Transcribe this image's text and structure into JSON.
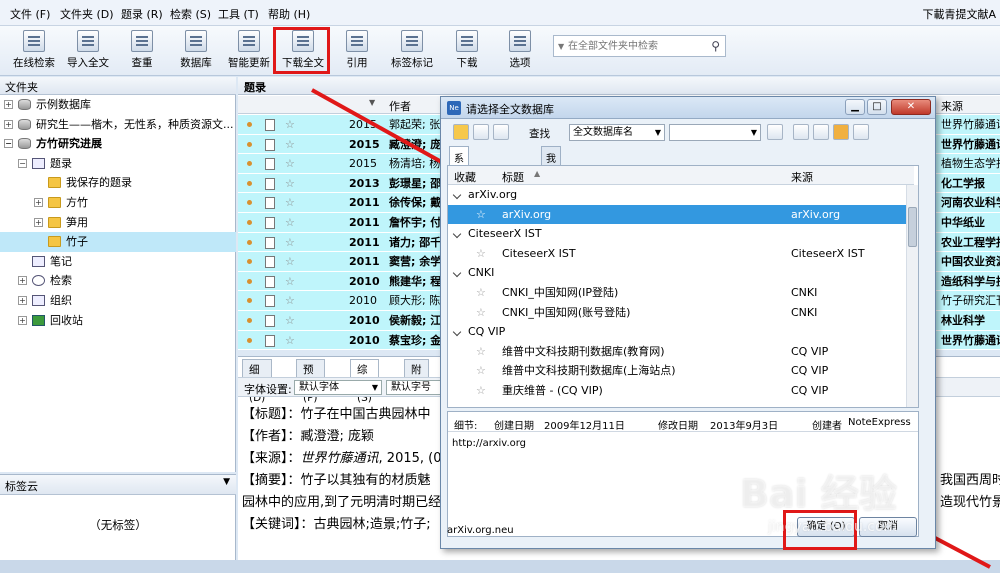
{
  "menu": [
    "文件 (F)",
    "文件夹 (D)",
    "题录 (R)",
    "检索 (S)",
    "工具 (T)",
    "帮助 (H)"
  ],
  "app_title": "下載青提文献A",
  "toolbar": [
    {
      "label": "在线检索",
      "icon": "online-search-icon"
    },
    {
      "label": "导入全文",
      "icon": "import-fulltext-icon"
    },
    {
      "label": "查重",
      "icon": "dedupe-icon"
    },
    {
      "label": "数据库",
      "icon": "database-icon"
    },
    {
      "label": "智能更新",
      "icon": "smart-update-icon"
    },
    {
      "label": "下载全文",
      "icon": "download-fulltext-icon"
    },
    {
      "label": "引用",
      "icon": "cite-icon"
    },
    {
      "label": "标签标记",
      "icon": "tag-icon"
    },
    {
      "label": "下载",
      "icon": "download-icon"
    },
    {
      "label": "选项",
      "icon": "options-icon"
    }
  ],
  "search": {
    "placeholder": "在全部文件夹中检索"
  },
  "leftpanel": {
    "title": "文件夹",
    "tree": [
      "示例数据库",
      "研究生——楷木，无性系，种质资源文...",
      "方竹研究进展",
      "题录",
      "我保存的题录",
      "方竹",
      "笋用",
      "竹子",
      "笔记",
      "检索",
      "组织",
      "回收站"
    ]
  },
  "tagcloud": {
    "title": "标签云",
    "empty": "（无标签）"
  },
  "main": {
    "title": "题录",
    "col_author": "作者",
    "col_source": "来源",
    "records": [
      {
        "year": "2015",
        "author": "郭起荣; 张",
        "source": "世界竹藤通讯"
      },
      {
        "year": "2015",
        "author": "臧澄澄; 庞",
        "source": "世界竹藤通讯"
      },
      {
        "year": "2015",
        "author": "杨清培; 杨",
        "source": "植物生态学报"
      },
      {
        "year": "2013",
        "author": "彭璟星; 邵",
        "source": "化工学报"
      },
      {
        "year": "2011",
        "author": "徐传保; 戴",
        "source": "河南农业科学"
      },
      {
        "year": "2011",
        "author": "詹怀宇; 付",
        "source": "中华纸业"
      },
      {
        "year": "2011",
        "author": "诸力; 邵千",
        "source": "农业工程学报"
      },
      {
        "year": "2011",
        "author": "窦营; 余学",
        "source": "中国农业资源"
      },
      {
        "year": "2010",
        "author": "熊建华; 程",
        "source": "造纸科学与技"
      },
      {
        "year": "2010",
        "author": "顾大形; 陈",
        "source": "竹子研究汇刊"
      },
      {
        "year": "2010",
        "author": "侯新毅; 江",
        "source": "林业科学"
      },
      {
        "year": "2010",
        "author": "蔡宝珍; 金",
        "source": "世界竹藤通讯"
      }
    ]
  },
  "detail": {
    "tabs": [
      "细节 (D)",
      "预览 (P)",
      "综述 (S)",
      "附件"
    ],
    "font_label": "字体设置:",
    "font_name": "默认字体",
    "font_size": "默认字号",
    "lines": [
      "【标题】：竹子在中国古典园林中",
      "【作者】：臧澄澄; 庞颖",
      "【来源】：",
      "世界竹藤通讯",
      ", 2015, (0",
      "【摘要】：竹子以其独有的材质魅",
      "园林中的应用,到了元明清时期已经",
      "【关键词】：古典园林;造景;竹子;",
      "我国西周时",
      "造现代竹景"
    ]
  },
  "dialog": {
    "title": "请选择全文数据库",
    "find_label": "查找",
    "find_field": "全文数据库名",
    "tabs": [
      "系统的全文数据库",
      "我的全文数据库"
    ],
    "col_fav": "收藏",
    "col_title": "标题",
    "col_source": "来源",
    "groups": [
      {
        "name": "arXiv.org",
        "rows": [
          {
            "title": "arXiv.org",
            "source": "arXiv.org",
            "selected": true
          }
        ]
      },
      {
        "name": "CiteseerX IST",
        "rows": [
          {
            "title": "CiteseerX IST",
            "source": "CiteseerX IST"
          }
        ]
      },
      {
        "name": "CNKI",
        "rows": [
          {
            "title": "CNKI_中国知网(IP登陆)",
            "source": "CNKI"
          },
          {
            "title": "CNKI_中国知网(账号登陆)",
            "source": "CNKI"
          }
        ]
      },
      {
        "name": "CQ VIP",
        "rows": [
          {
            "title": "维普中文科技期刊数据库(教育网)",
            "source": "CQ VIP"
          },
          {
            "title": "维普中文科技期刊数据库(上海站点)",
            "source": "CQ VIP"
          },
          {
            "title": "重庆维普 - (CQ VIP)",
            "source": "CQ VIP"
          }
        ]
      }
    ],
    "info_label": "细节:",
    "created_label": "创建日期",
    "created": "2009年12月11日",
    "modified_label": "修改日期",
    "modified": "2013年9月3日",
    "creator_label": "创建者",
    "creator": "NoteExpress",
    "url": "http://arxiv.org",
    "footer": "arXiv.org.neu",
    "ok": "确定 (O)",
    "cancel": "取消"
  },
  "watermark": {
    "logo": "Bai 经验",
    "url": "jingyan.baidu.com"
  },
  "colors": {
    "accent": "#3398e0",
    "highlight_row": "#bff5fb",
    "annotation": "#e01818"
  }
}
